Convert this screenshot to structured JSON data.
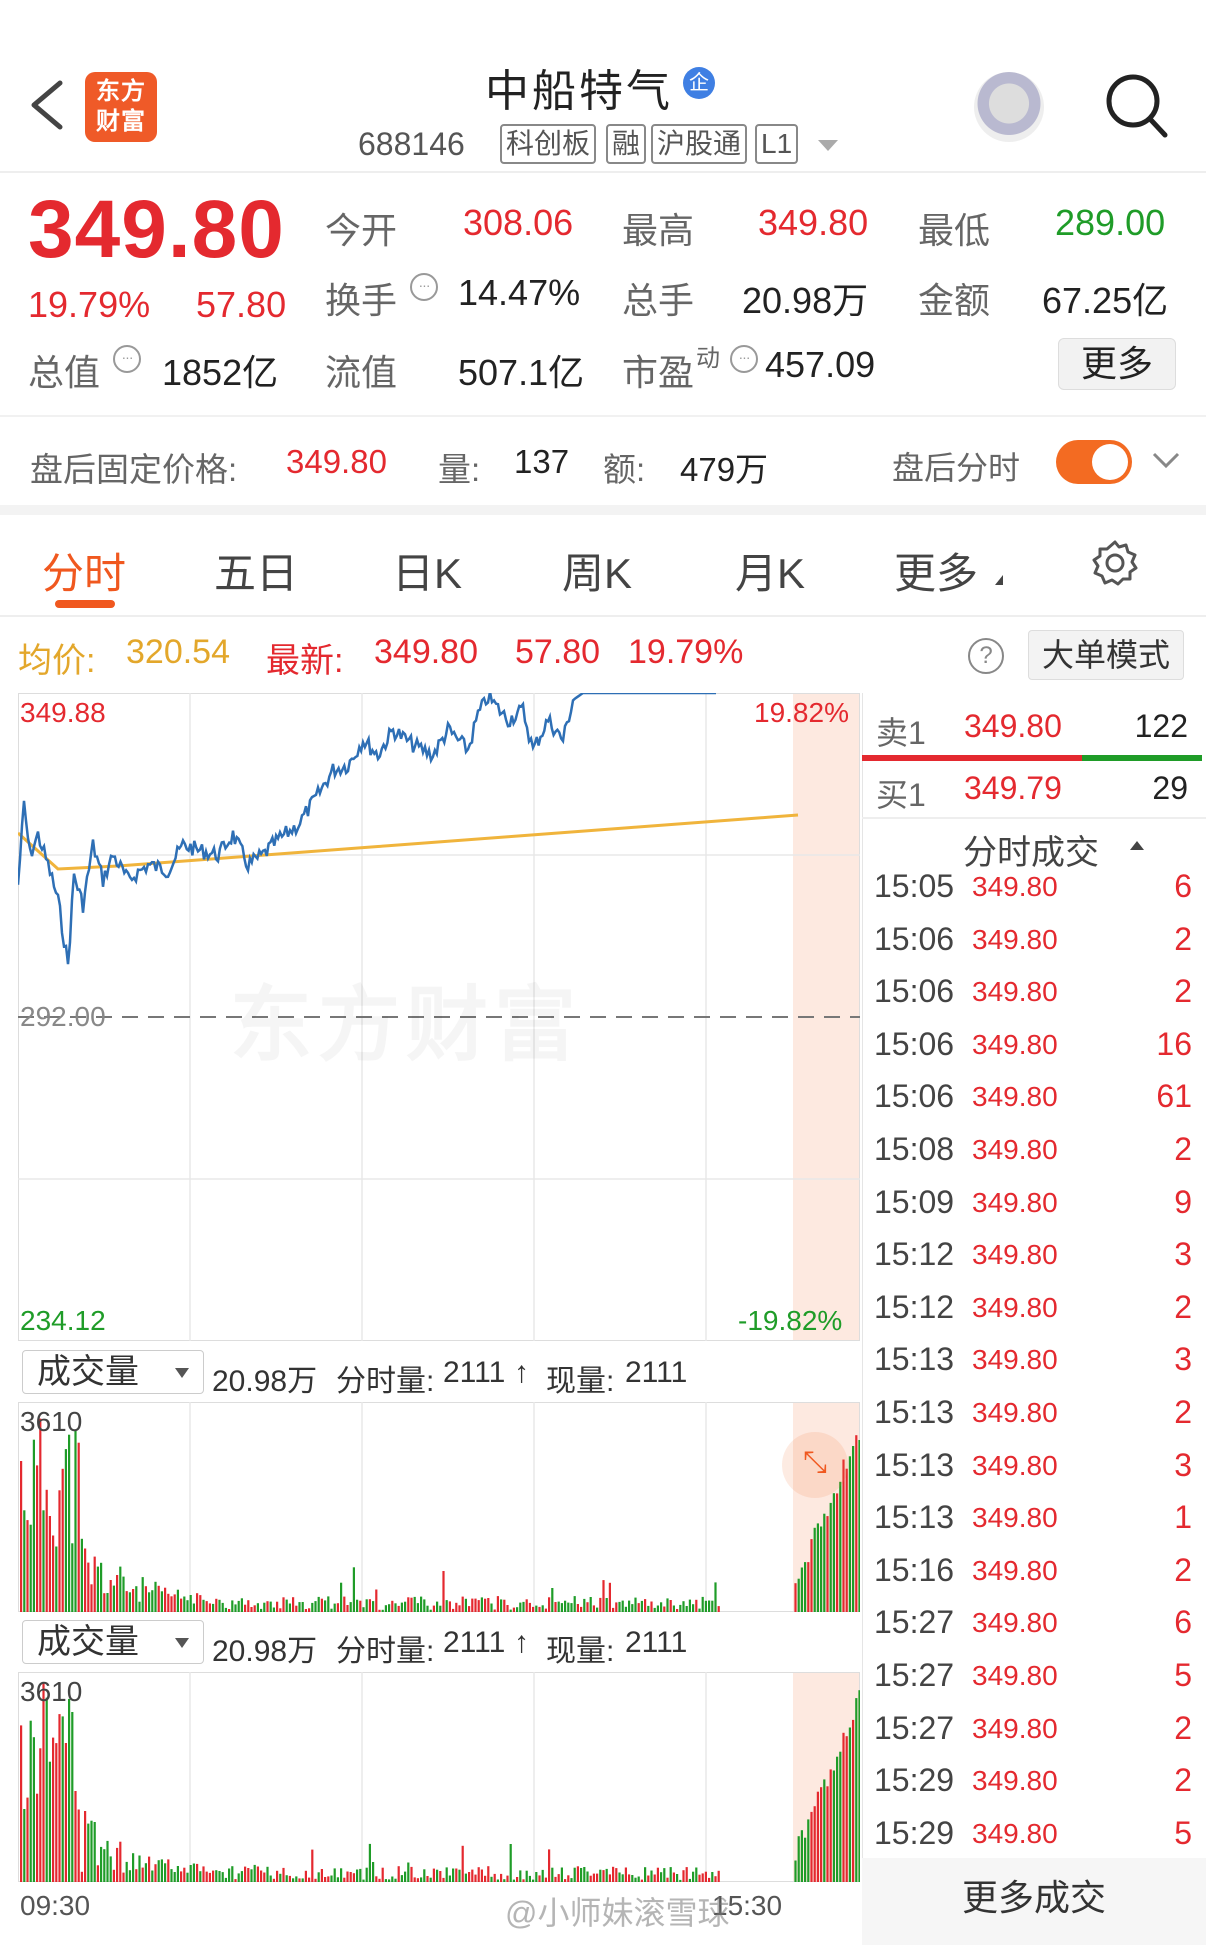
{
  "header": {
    "logo_line1": "东方",
    "logo_line2": "财富",
    "stock_name": "中船特气",
    "badge": "企",
    "code": "688146",
    "tags": [
      "科创板",
      "融",
      "沪股通",
      "L1"
    ]
  },
  "quote": {
    "price": "349.80",
    "change_pct": "19.79%",
    "change_amt": "57.80",
    "open_label": "今开",
    "open_value": "308.06",
    "high_label": "最高",
    "high_value": "349.80",
    "low_label": "最低",
    "low_value": "289.00",
    "turnover_label": "换手",
    "turnover_value": "14.47%",
    "volume_label": "总手",
    "volume_value": "20.98万",
    "amount_label": "金额",
    "amount_value": "67.25亿",
    "mktcap_label": "总值",
    "mktcap_value": "1852亿",
    "float_label": "流值",
    "float_value": "507.1亿",
    "pe_label": "市盈",
    "pe_sup": "动",
    "pe_value": "457.09",
    "more_button": "更多"
  },
  "after_hours": {
    "label": "盘后固定价格:",
    "price": "349.80",
    "vol_label": "量:",
    "vol_value": "137",
    "amt_label": "额:",
    "amt_value": "479万",
    "toggle_label": "盘后分时",
    "toggle_on": true
  },
  "tabs": [
    "分时",
    "五日",
    "日K",
    "周K",
    "月K",
    "更多"
  ],
  "active_tab": "分时",
  "info_line": {
    "avg_label": "均价:",
    "avg_value": "320.54",
    "latest_label": "最新:",
    "latest_price": "349.80",
    "latest_change": "57.80",
    "latest_pct": "19.79%",
    "big_order_button": "大单模式",
    "help": "?"
  },
  "chart_labels": {
    "top_left": "349.88",
    "top_right": "19.82%",
    "bottom_left": "234.12",
    "bottom_right": "-19.82%",
    "mid_left": "292.00",
    "watermark": "东方财富",
    "time_start": "09:30",
    "time_end": "15:30"
  },
  "volume_panels": [
    {
      "selector": "成交量",
      "total": "20.98万",
      "seg_label": "分时量:",
      "seg_value": "2111",
      "arrow": "↑",
      "now_label": "现量:",
      "now_value": "2111",
      "max": "3610"
    },
    {
      "selector": "成交量",
      "total": "20.98万",
      "seg_label": "分时量:",
      "seg_value": "2111",
      "arrow": "↑",
      "now_label": "现量:",
      "now_value": "2111",
      "max": "3610"
    }
  ],
  "order_book": {
    "sell_label": "卖1",
    "sell_price": "349.80",
    "sell_vol": "122",
    "buy_label": "买1",
    "buy_price": "349.79",
    "buy_vol": "29"
  },
  "ticks_header": "分时成交",
  "ticks": [
    {
      "time": "15:05",
      "price": "349.80",
      "vol": "6"
    },
    {
      "time": "15:06",
      "price": "349.80",
      "vol": "2"
    },
    {
      "time": "15:06",
      "price": "349.80",
      "vol": "2"
    },
    {
      "time": "15:06",
      "price": "349.80",
      "vol": "16"
    },
    {
      "time": "15:06",
      "price": "349.80",
      "vol": "61"
    },
    {
      "time": "15:08",
      "price": "349.80",
      "vol": "2"
    },
    {
      "time": "15:09",
      "price": "349.80",
      "vol": "9"
    },
    {
      "time": "15:12",
      "price": "349.80",
      "vol": "3"
    },
    {
      "time": "15:12",
      "price": "349.80",
      "vol": "2"
    },
    {
      "time": "15:13",
      "price": "349.80",
      "vol": "3"
    },
    {
      "time": "15:13",
      "price": "349.80",
      "vol": "2"
    },
    {
      "time": "15:13",
      "price": "349.80",
      "vol": "3"
    },
    {
      "time": "15:13",
      "price": "349.80",
      "vol": "1"
    },
    {
      "time": "15:16",
      "price": "349.80",
      "vol": "2"
    },
    {
      "time": "15:27",
      "price": "349.80",
      "vol": "6"
    },
    {
      "time": "15:27",
      "price": "349.80",
      "vol": "5"
    },
    {
      "time": "15:27",
      "price": "349.80",
      "vol": "2"
    },
    {
      "time": "15:29",
      "price": "349.80",
      "vol": "2"
    },
    {
      "time": "15:29",
      "price": "349.80",
      "vol": "5"
    }
  ],
  "more_trades": "更多成交",
  "weibo_watermark": "@小师妹滚雪球",
  "colors": {
    "up": "#e4292f",
    "down": "#1f9c28",
    "accent": "#f0581f",
    "price_line": "#2e6fb5",
    "avg_line": "#f0b43c"
  }
}
